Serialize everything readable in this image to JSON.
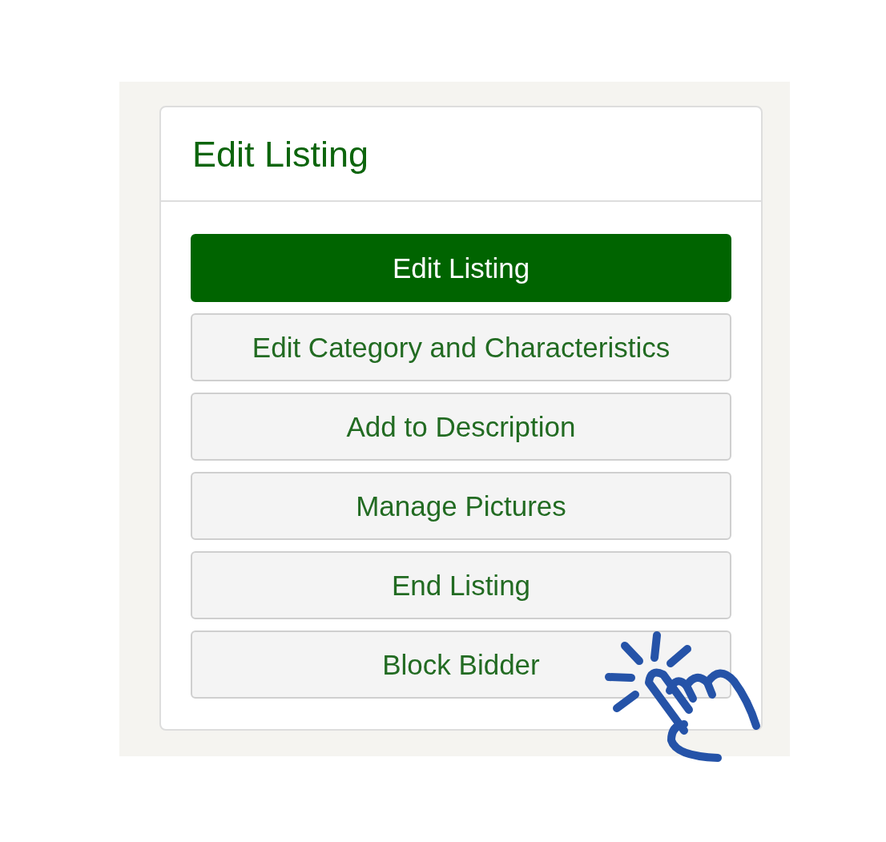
{
  "panel": {
    "title": "Edit Listing"
  },
  "buttons": [
    {
      "label": "Edit Listing",
      "selected": true
    },
    {
      "label": "Edit Category and Characteristics",
      "selected": false
    },
    {
      "label": "Add to Description",
      "selected": false
    },
    {
      "label": "Manage Pictures",
      "selected": false
    },
    {
      "label": "End Listing",
      "selected": false
    },
    {
      "label": "Block Bidder",
      "selected": false
    }
  ]
}
